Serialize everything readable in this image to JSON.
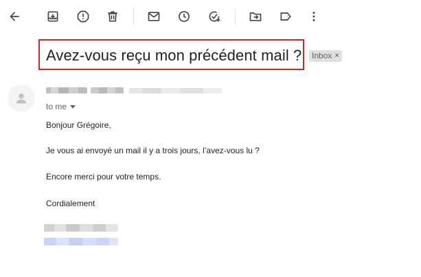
{
  "toolbar": {
    "icons": [
      "back-arrow-icon",
      "archive-icon",
      "report-spam-icon",
      "delete-icon",
      "mark-unread-icon",
      "snooze-icon",
      "add-to-tasks-icon",
      "move-to-icon",
      "labels-icon",
      "more-vert-icon"
    ]
  },
  "email": {
    "subject": "Avez-vous reçu mon précédent mail ?",
    "label_chip": "Inbox",
    "chip_close": "×",
    "recipient_text": "to me",
    "body": {
      "greeting": "Bonjour Grégoire,",
      "line1": "Je vous ai envoyé un mail il y a trois jours, l’avez-vous lu ?",
      "line2": "Encore merci pour votre temps.",
      "closing": "Cordialement"
    }
  },
  "colors": {
    "highlight_border": "#e0201b",
    "icon": "#444746",
    "chip_bg": "#e0e0e0",
    "secondary_text": "#5f6368"
  }
}
